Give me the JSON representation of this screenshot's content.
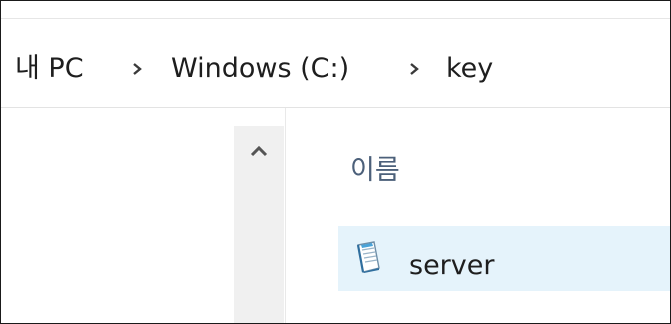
{
  "breadcrumb": {
    "items": [
      {
        "label": "내 PC"
      },
      {
        "label": "Windows (C:)"
      },
      {
        "label": "key"
      }
    ],
    "separator_icon": "chevron-right-icon"
  },
  "scrollbar": {
    "up_icon": "chevron-up-icon"
  },
  "file_list": {
    "column_header": "이름",
    "rows": [
      {
        "name": "server",
        "icon": "text-file-icon",
        "selected_hover": true
      }
    ]
  },
  "colors": {
    "row_highlight": "#e5f3fb",
    "header_text": "#4c607a",
    "scrollbar_track": "#f0f0f0"
  }
}
